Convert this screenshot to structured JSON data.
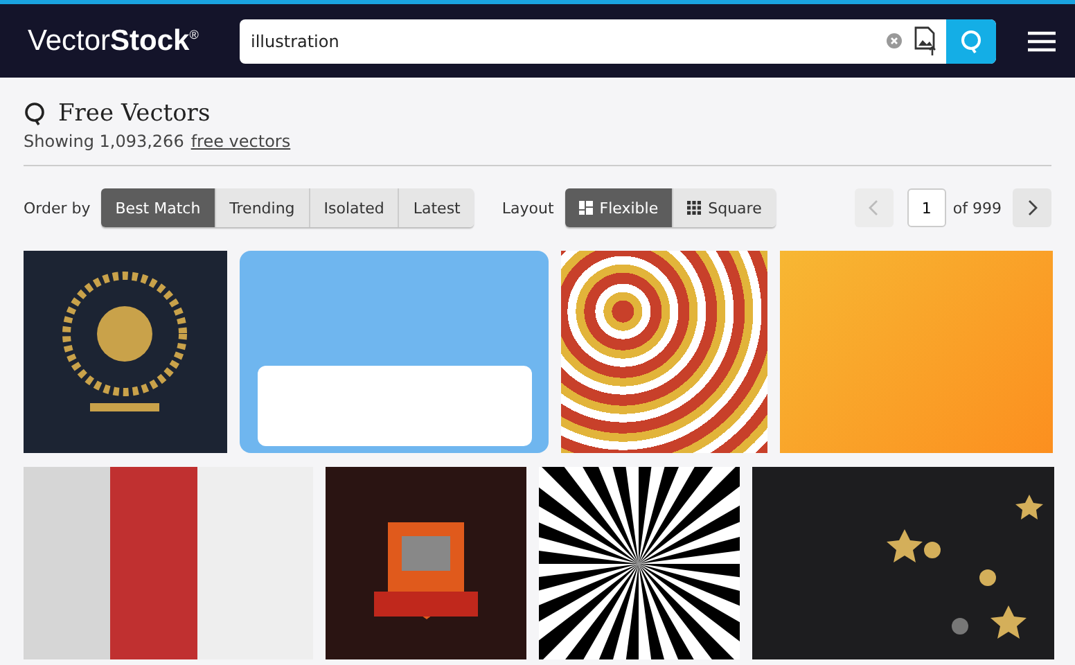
{
  "header": {
    "logo": "Vector**Stock**$^{®}$",
    "search_value": "illustration"
  },
  "heading": {
    "title": "Free Vectors",
    "showing": "Showing 1,093,266",
    "link": "free vectors"
  },
  "order": {
    "label": "Order by",
    "options": [
      {
        "label": "Best Match",
        "selected": true
      },
      {
        "label": "Trending",
        "selected": false
      },
      {
        "label": "Isolated",
        "selected": false
      },
      {
        "label": "Latest",
        "selected": false
      }
    ]
  },
  "layout": {
    "label": "Layout",
    "options": [
      {
        "label": "Flexible",
        "kind": "flexible",
        "selected": true
      },
      {
        "label": "Square",
        "kind": "square",
        "selected": false
      }
    ]
  },
  "pagination": {
    "page": "1",
    "total": "of 999"
  },
  "rows": [
    [
      {
        "kind": "luxury"
      },
      {
        "kind": "nametag"
      },
      {
        "kind": "leaves"
      },
      {
        "kind": "gradient"
      }
    ],
    [
      {
        "kind": "brochure"
      },
      {
        "kind": "mascot"
      },
      {
        "kind": "sunburst"
      },
      {
        "kind": "confetti"
      }
    ]
  ]
}
